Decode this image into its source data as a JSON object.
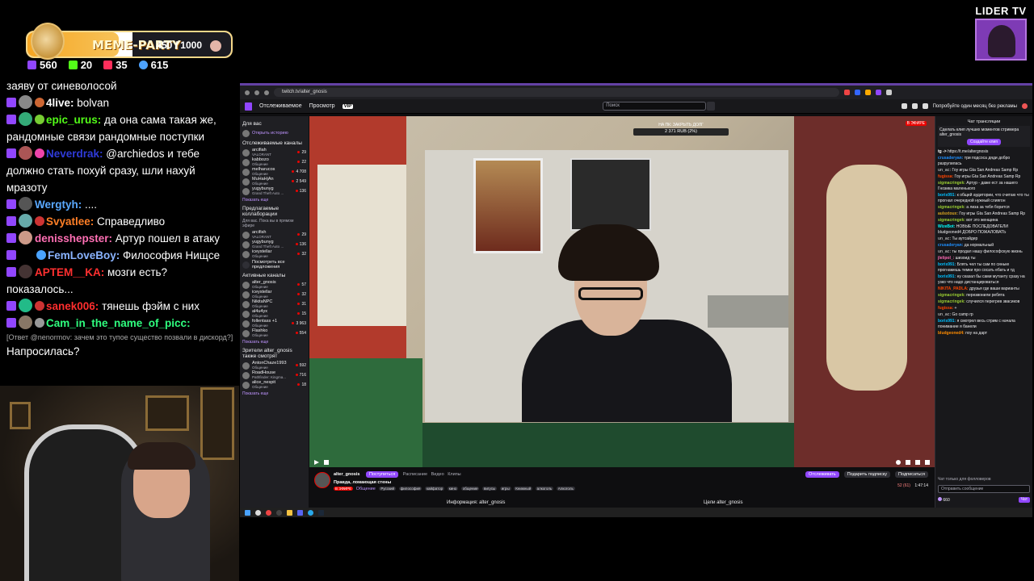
{
  "points_widget": {
    "label": "MEME-PARTY",
    "count": "450 / 1000",
    "progress_fraction": 0.45
  },
  "stats": [
    {
      "icon": "chat-icon",
      "value": "560",
      "color": "#9146ff"
    },
    {
      "icon": "kick-icon",
      "value": "20",
      "color": "#53fc18"
    },
    {
      "icon": "vk-live-icon",
      "value": "35",
      "color": "#ff2e5b"
    },
    {
      "icon": "viewers-icon",
      "value": "615",
      "color": "#4da3ff"
    }
  ],
  "overlay_chat": [
    {
      "user": "",
      "color": "#ffffff",
      "text": "заяву от синеволосой"
    },
    {
      "user": "4live:",
      "color": "#ffffff",
      "text": " bolvan"
    },
    {
      "user": "epic_urus:",
      "color": "#53fc18",
      "text": " да она сама такая же, рандомные связи рандомные поступки"
    },
    {
      "user": "Neverdrak:",
      "color": "#2f3bd9",
      "text": " @archiedos и тебе должно стать похуй сразу, шли нахуй мразоту"
    },
    {
      "user": "Wergtyh:",
      "color": "#5aa9ff",
      "text": " ...."
    },
    {
      "user": "Svyatlee:",
      "color": "#ff7f27",
      "text": " Справедливо"
    },
    {
      "user": "denisshepster:",
      "color": "#ff6fb4",
      "text": " Артур пошел в атаку"
    },
    {
      "user": "FemLoveBoy:",
      "color": "#8ab4ff",
      "text": " Философия Нищсе"
    },
    {
      "user": "APTEM__KA:",
      "color": "#ff3030",
      "text": " мозги есть? показалось..."
    },
    {
      "user": "sanek006:",
      "color": "#ff2e2e",
      "text": " тянешь фэйм с них"
    },
    {
      "user": "Cam_in_the_name_of_picc:",
      "color": "#2fff7f",
      "text": ""
    }
  ],
  "reply_note": "[Ответ @nenormov: зачем это тупое существо позвали в дискорд?]",
  "last_message": "Напросилась?",
  "lider": {
    "title": "LIDER TV"
  },
  "browser": {
    "url": "twitch.tv/alter_gnosis",
    "nav_following": "Отслеживаемое",
    "nav_browse": "Просмотр",
    "vip": "VIP",
    "search_placeholder": "Поиск",
    "promo": "Попробуйте один месяц без рекламы"
  },
  "sidenav": {
    "for_you": "Для вас",
    "history": "Открыть историю",
    "followed_heading": "Отслеживаемые каналы",
    "followed": [
      {
        "name": "arcifiah",
        "game": "VALORANT",
        "count": "29"
      },
      {
        "name": "kabbozo",
        "game": "Общение",
        "count": "22"
      },
      {
        "name": "melharucos",
        "game": "Общение",
        "count": "4 708"
      },
      {
        "name": "MuHaHjAn",
        "game": "Общение",
        "count": "2 549"
      },
      {
        "name": "yugybunyg",
        "game": "Grand Theft Auto ...",
        "count": "136"
      }
    ],
    "show_more": "Показать еще",
    "collab_heading": "Предлагаемые коллаборации",
    "collab_sub": "Для вас. Пока вы в прямом эфире",
    "collab": [
      {
        "name": "arcifish",
        "game": "VALORANT",
        "count": "29"
      },
      {
        "name": "yugybunyg",
        "game": "Grand Theft Auto ...",
        "count": "136"
      },
      {
        "name": "iceystellar",
        "game": "Общение",
        "count": "32"
      }
    ],
    "show_suggested": "Посмотреть все предложения",
    "active_heading": "Активные каналы",
    "active": [
      {
        "name": "alter_gnosis",
        "game": "Общение",
        "count": "57"
      },
      {
        "name": "iceystellar",
        "game": "Общение",
        "count": "32"
      },
      {
        "name": "NikitaNPC",
        "game": "Общение",
        "count": "31"
      },
      {
        "name": "al4u4yx",
        "game": "Общение",
        "count": "15"
      },
      {
        "name": "follentass +1",
        "game": "Общение",
        "count": "3 963"
      },
      {
        "name": "Flashko",
        "game": "Общение",
        "count": "554"
      }
    ],
    "watchers_heading": "Зрители alter_gnosis также смотрят",
    "watchers": [
      {
        "name": "AntonChaze1993",
        "game": "Общение",
        "count": "592"
      },
      {
        "name": "RoadHouse",
        "game": "Pathfinder: Kingma...",
        "count": "716"
      },
      {
        "name": "alice_nespit",
        "game": "Общение",
        "count": "18"
      }
    ]
  },
  "player": {
    "goal_title": "НА ПК: ЗАКРЫТЬ ДОЛГ",
    "goal_value": "2 371 RUB (2%)",
    "live": "В ЭФИРЕ"
  },
  "stream_info": {
    "channel": "alter_gnosis",
    "title": "Правда, ломающая стены",
    "category": "Общение",
    "follow": "Поступиться",
    "schedule": "Расписание",
    "video": "Видео",
    "clips": "Клипы",
    "tags": [
      "Русский",
      "философия",
      "кайфатор",
      "кино",
      "общение",
      "вигусы",
      "игры",
      "Книжный",
      "алкоголь",
      "Алкоголь"
    ],
    "unfollow": "Отслеживать",
    "gift": "Подарить подписку",
    "subscribe": "Подписаться",
    "viewers": "52 (61)",
    "uptime": "1:47:14",
    "info_label": "Информация: alter_gnosis",
    "goals_label": "Цели alter_gnosis"
  },
  "twitch_chat": {
    "title": "Чат трансляции",
    "pinned_text": "Сделать клип лучших моментов стримера alter_gnosis",
    "create_clip": "Создайте клип",
    "messages": [
      {
        "user": "tg ->",
        "color": "#ffffff",
        "text": " https://t.me/altergnosis"
      },
      {
        "user": "crusaderyan:",
        "color": "#1e90ff",
        "text": " три подсоса дяди добро разрулилась"
      },
      {
        "user": "un_ac:",
        "color": "#aaaaaa",
        "text": " Гоу игры Gta San Andreas Samp Rp"
      },
      {
        "user": "fugissa:",
        "color": "#ff4500",
        "text": " Гоу игры Gta San Andreas Samp Rp"
      },
      {
        "user": "sigmacringek:",
        "color": "#9acd32",
        "text": " Артур - даже ест за нашего Гнозика маленького"
      },
      {
        "user": "boris991:",
        "color": "#00bfff",
        "text": " к общей аудитории, что считаю что ты прогнал очередной нужный слиягон"
      },
      {
        "user": "sigmacringek:",
        "color": "#9acd32",
        "text": " а лиза за тебя борится"
      },
      {
        "user": "aulsxtoux:",
        "color": "#daa520",
        "text": " Гоу игры Gta San Andreas Samp Rp"
      },
      {
        "user": "sigmacringek:",
        "color": "#9acd32",
        "text": " вот это женщина"
      },
      {
        "user": "WizeBot:",
        "color": "#00ffff",
        "text": " НОВЫЕ ПОСЛЕДОВАТЕЛИ bludgeoned4 ДОБРО ПОЖАЛОВАТЬ"
      },
      {
        "user": "un_ac:",
        "color": "#aaaaaa",
        "text": " Ты аутсайдер"
      },
      {
        "user": "crusaderyan:",
        "color": "#1e90ff",
        "text": " да нормальный"
      },
      {
        "user": "un_ac:",
        "color": "#aaaaaa",
        "text": " ты продал нашу философскую жизнь"
      },
      {
        "user": "jlelipol_:",
        "color": "#ff69b4",
        "text": " шизоид ты"
      },
      {
        "user": "boris991:",
        "color": "#00bfff",
        "text": " Блять чел ты сам по синьке прогнамешь темки про сосать ебать и тд"
      },
      {
        "user": "boris991:",
        "color": "#00bfff",
        "text": " ну сказал бы сами мутанту сразу на узко что надо дистанцироваться"
      },
      {
        "user": "NIKITA_PADLA:",
        "color": "#ff4500",
        "text": " друзья где ваши варианты"
      },
      {
        "user": "sigmacringek:",
        "color": "#9acd32",
        "text": " перезвонили ребята"
      },
      {
        "user": "sigmacringek:",
        "color": "#9acd32",
        "text": " случился перегрев звасиков"
      },
      {
        "user": "fugissa:",
        "color": "#ff4500",
        "text": " +"
      },
      {
        "user": "un_ac:",
        "color": "#aaaaaa",
        "text": " Go camp rp"
      },
      {
        "user": "boris991:",
        "color": "#00bfff",
        "text": " я смотрел весь стрим с начала понимание я банели"
      },
      {
        "user": "bludgeoned4:",
        "color": "#ff8c00",
        "text": " поу на дарт"
      }
    ],
    "followers_only": "Чат только для фолловеров",
    "input_placeholder": "Отправить сообщение",
    "points": "660",
    "send": "Чат"
  }
}
